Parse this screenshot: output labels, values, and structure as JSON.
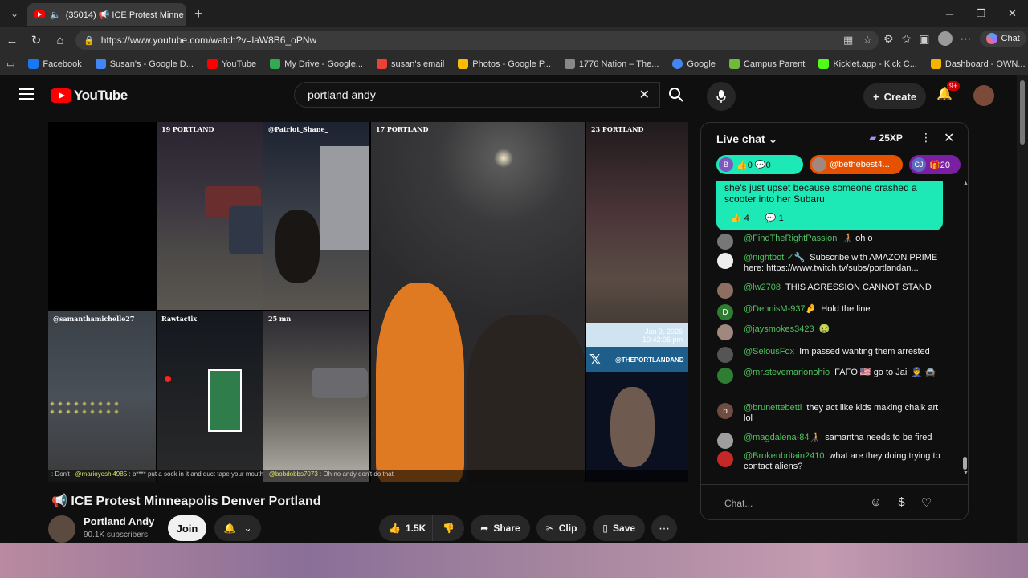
{
  "browser": {
    "tab_title": "(35014) 📢 ICE Protest Minne",
    "url": "https://www.youtube.com/watch?v=laW8B6_oPNw",
    "chat_button": "Chat",
    "bookmarks": [
      {
        "label": "Facebook",
        "color": "#1877f2"
      },
      {
        "label": "Susan's - Google D...",
        "color": "#4285f4"
      },
      {
        "label": "YouTube",
        "color": "#ff0000"
      },
      {
        "label": "My Drive - Google...",
        "color": "#34a853"
      },
      {
        "label": "susan's email",
        "color": "#ea4335"
      },
      {
        "label": "Photos - Google P...",
        "color": "#fbbc04"
      },
      {
        "label": "1776 Nation – The...",
        "color": "#888888"
      },
      {
        "label": "Google",
        "color": "#4285f4"
      },
      {
        "label": "Campus Parent",
        "color": "#6cbb3c"
      },
      {
        "label": "Kicklet.app - Kick C...",
        "color": "#53fc18"
      },
      {
        "label": "Dashboard - OWN...",
        "color": "#f4b400"
      }
    ]
  },
  "youtube": {
    "logo_text": "YouTube",
    "search_value": "portland andy",
    "create_label": "Create",
    "notif_badge": "9+"
  },
  "video": {
    "tiles": {
      "t1": "19 PORTLAND",
      "t2": "@Patriot_Shane_",
      "t3": "17 PORTLAND",
      "t4": "23 PORTLAND",
      "t5": "@samanthamichelle27",
      "t6": "Rawtactix",
      "t7": "25 mn"
    },
    "timestamp_date": "Jan 9, 2026",
    "timestamp_time": "10:42:06 pm",
    "x_handle": "@THEPORTLANDAND",
    "ticker": {
      "pre": ": Don't",
      "u1": "@marioyoshi4985",
      "m1": ": b**** put a sock in it and duct tape your mouth",
      "u2": "@bobdobbs7073",
      "m2": ": Oh no andy don't do that"
    },
    "title": "📢 ICE Protest Minneapolis Denver Portland",
    "channel": "Portland Andy",
    "subscribers": "90.1K subscribers",
    "join_label": "Join",
    "likes": "1.5K",
    "share_label": "Share",
    "clip_label": "Clip",
    "save_label": "Save"
  },
  "chat": {
    "header": "Live chat",
    "xp": "25XP",
    "tickers": [
      {
        "avatar": "B",
        "text": "👍0 💬0",
        "bg": "#1de9b6",
        "avatar_bg": "#7e57c2",
        "fg": "#0f0f0f"
      },
      {
        "avatar": "",
        "text": "@bethebest4...",
        "bg": "#e65100",
        "avatar_bg": "#a1887f",
        "fg": "#ffffff"
      },
      {
        "avatar": "CJ",
        "text": "🎁20",
        "bg": "#7b1fa2",
        "avatar_bg": "#5c6bc0",
        "fg": "#ffffff"
      }
    ],
    "pinned_text": "she's just upset because someone crashed a scooter into her Subaru",
    "pinned_likes": "4",
    "pinned_replies": "1",
    "messages": [
      {
        "author": "@FindTheRightPassion",
        "text": "🧑‍🦯 oh o",
        "color": "#777777",
        "initial": ""
      },
      {
        "author": "@nightbot ✓🔧",
        "text": "Subscribe with AMAZON PRIME here: https://www.twitch.tv/subs/portlandan...",
        "color": "#eeeeee",
        "initial": ""
      },
      {
        "author": "@lw2708",
        "text": "THIS AGRESSION CANNOT STAND",
        "color": "#8d6e63",
        "initial": ""
      },
      {
        "author": "@DennisM-937🤌",
        "text": "Hold the line",
        "color": "#2e7d32",
        "initial": "D"
      },
      {
        "author": "@jaysmokes3423",
        "text": "🤢",
        "color": "#a1887f",
        "initial": ""
      },
      {
        "author": "@SelousFox",
        "text": "Im passed wanting them arrested",
        "color": "#555555",
        "initial": ""
      },
      {
        "author": "@mr.stevemarionohio",
        "text": "FAFO 🇺🇸 go to Jail 👮 🚔",
        "color": "#2e7d32",
        "initial": ""
      },
      {
        "author": "@brunettebetti",
        "text": "they act like kids making chalk art lol",
        "color": "#6d4c41",
        "initial": "b"
      },
      {
        "author": "@magdalena-84🧑‍🦯",
        "text": "samantha needs to be fired",
        "color": "#9e9e9e",
        "initial": ""
      },
      {
        "author": "@Brokenbritain2410",
        "text": "what are they doing trying to contact aliens?",
        "color": "#c62828",
        "initial": ""
      }
    ],
    "input_placeholder": "Chat..."
  }
}
